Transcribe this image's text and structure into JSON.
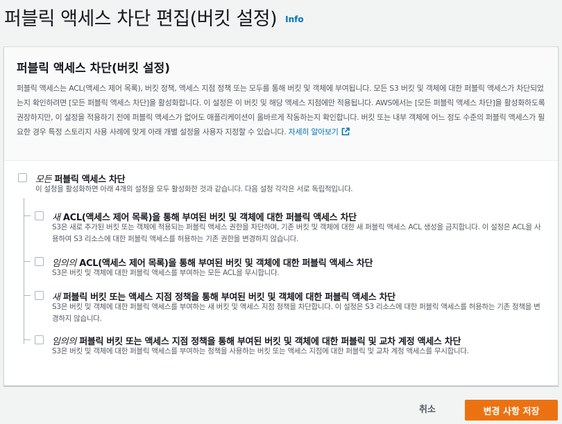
{
  "page": {
    "title": "퍼블릭 액세스 차단 편집(버킷 설정)",
    "info_link": "Info"
  },
  "panel": {
    "title": "퍼블릭 액세스 차단(버킷 설정)",
    "description": "퍼블릭 액세스는 ACL(액세스 제어 목록), 버킷 정책, 액세스 지점 정책 또는 모두를 통해 버킷 및 객체에 부여됩니다. 모든 S3 버킷 및 객체에 대한 퍼블릭 액세스가 차단되었는지 확인하려면 [모든 퍼블릭 액세스 차단]을 활성화합니다. 이 설정은 이 버킷 및 해당 액세스 지점에만 적용됩니다. AWS에서는 [모든 퍼블릭 액세스 차단]을 활성화하도록 권장하지만, 이 설정을 적용하기 전에 퍼블릭 액세스가 없어도 애플리케이션이 올바르게 작동하는지 확인합니다. 버킷 또는 내부 객체에 어느 정도 수준의 퍼블릭 액세스가 필요한 경우 특정 스토리지 사용 사례에 맞게 아래 개별 설정을 사용자 지정할 수 있습니다.",
    "learn_more": "자세히 알아보기",
    "learn_more_icon": "external-link-icon"
  },
  "options": {
    "master": {
      "emphasis": "모든",
      "label": " 퍼블릭 액세스 차단",
      "description": "이 설정을 활성화하면 아래 4개의 설정을 모두 활성화한 것과 같습니다. 다음 설정 각각은 서로 독립적입니다.",
      "checked": false
    },
    "items": [
      {
        "emphasis": "새",
        "label": " ACL(액세스 제어 목록)을 통해 부여된 버킷 및 객체에 대한 퍼블릭 액세스 차단",
        "description": "S3은 새로 추가된 버킷 또는 객체에 적용되는 퍼블릭 액세스 권한을 차단하며, 기존 버킷 및 객체에 대한 새 퍼블릭 액세스 ACL 생성을 금지합니다. 이 설정은 ACL을 사용하여 S3 리소스에 대한 퍼블릭 액세스를 허용하는 기존 권한을 변경하지 않습니다.",
        "checked": false
      },
      {
        "emphasis": "임의의",
        "label": " ACL(액세스 제어 목록)을 통해 부여된 버킷 및 객체에 대한 퍼블릭 액세스 차단",
        "description": "S3은 버킷 및 객체에 대한 퍼블릭 액세스를 부여하는 모든 ACL을 무시합니다.",
        "checked": false
      },
      {
        "emphasis": "새",
        "label": " 퍼블릭 버킷 또는 액세스 지점 정책을 통해 부여된 버킷 및 객체에 대한 퍼블릭 액세스 차단",
        "description": "S3은 버킷 및 객체에 대한 퍼블릭 액세스를 부여하는 새 버킷 및 액세스 지점 정책을 차단합니다. 이 설정은 S3 리소스에 대한 퍼블릭 액세스를 허용하는 기존 정책을 변경하지 않습니다.",
        "checked": false
      },
      {
        "emphasis": "임의의",
        "label": " 퍼블릭 버킷 또는 액세스 지점 정책을 통해 부여된 버킷 및 객체에 대한 퍼블릭 및 교차 계정 액세스 차단",
        "description": "S3은 버킷 및 객체에 대한 퍼블릭 액세스를 부여하는 정책을 사용하는 버킷 또는 액세스 지점에 대한 퍼블릭 및 교차 계정 액세스를 무시합니다.",
        "checked": false
      }
    ]
  },
  "footer": {
    "cancel_label": "취소",
    "save_label": "변경 사항 저장"
  },
  "colors": {
    "accent": "#ec7211",
    "link": "#0073bb",
    "background": "#f2f3f3"
  }
}
